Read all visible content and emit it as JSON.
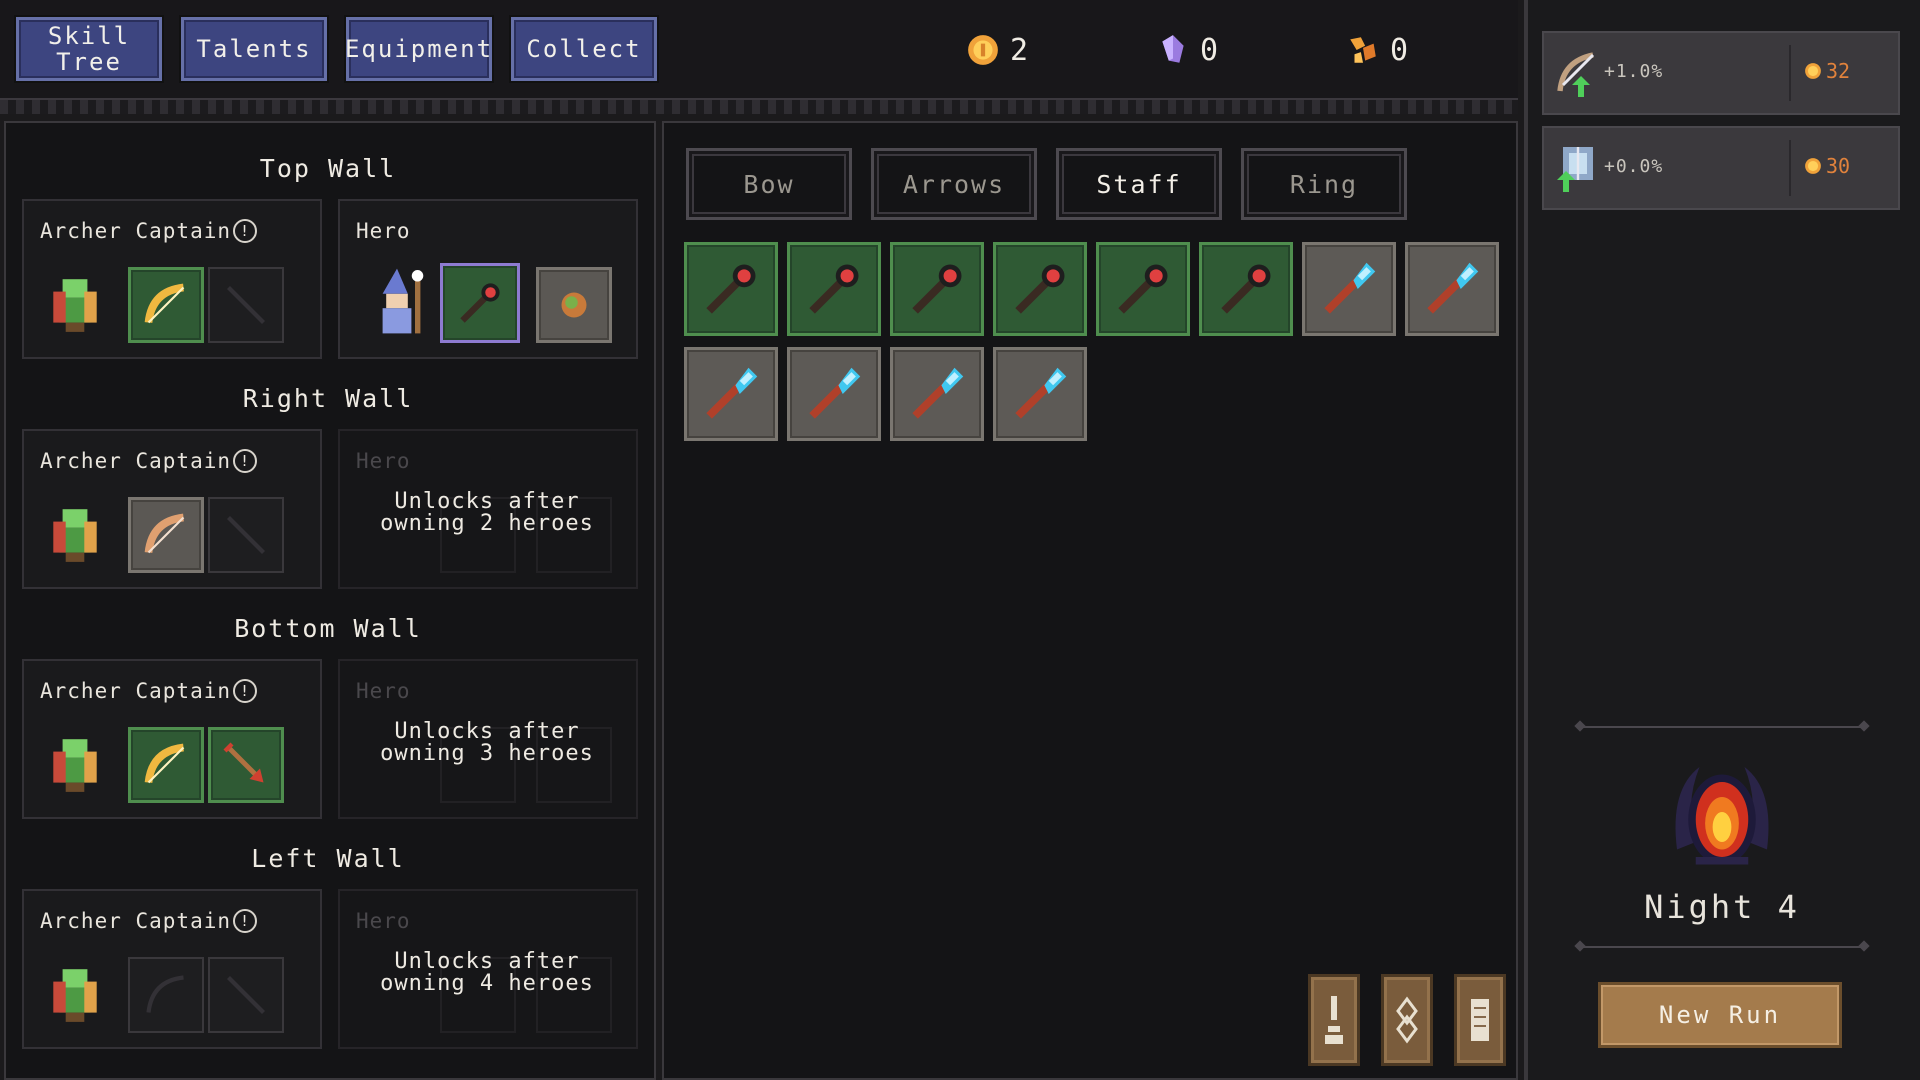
{
  "nav": {
    "tabs": [
      {
        "label": "Skill\nTree"
      },
      {
        "label": "Talents"
      },
      {
        "label": "Equipment"
      },
      {
        "label": "Collect"
      }
    ]
  },
  "currencies": [
    {
      "icon": "gold-coin-icon",
      "value": "2"
    },
    {
      "icon": "purple-crystal-icon",
      "value": "0"
    },
    {
      "icon": "orange-shard-icon",
      "value": "0"
    }
  ],
  "walls": [
    {
      "title": "Top Wall",
      "unit": "Archer Captain",
      "hero_label": "Hero",
      "unlock_text": ""
    },
    {
      "title": "Right Wall",
      "unit": "Archer Captain",
      "hero_label": "Hero",
      "unlock_text": "Unlocks after\nowning 2 heroes"
    },
    {
      "title": "Bottom Wall",
      "unit": "Archer Captain",
      "hero_label": "Hero",
      "unlock_text": "Unlocks after\nowning 3 heroes"
    },
    {
      "title": "Left Wall",
      "unit": "Archer Captain",
      "hero_label": "Hero",
      "unlock_text": "Unlocks after\nowning 4 heroes"
    }
  ],
  "info_glyph": "!",
  "equipment": {
    "categories": [
      {
        "label": "Bow"
      },
      {
        "label": "Arrows"
      },
      {
        "label": "Staff",
        "active": true
      },
      {
        "label": "Ring"
      }
    ],
    "inventory": [
      {
        "item": "red-gem-staff",
        "rarity": "green"
      },
      {
        "item": "red-gem-staff",
        "rarity": "green"
      },
      {
        "item": "red-gem-staff",
        "rarity": "green"
      },
      {
        "item": "red-gem-staff",
        "rarity": "green"
      },
      {
        "item": "red-gem-staff",
        "rarity": "green"
      },
      {
        "item": "red-gem-staff",
        "rarity": "green"
      },
      {
        "item": "blue-crystal-staff",
        "rarity": "grey"
      },
      {
        "item": "blue-crystal-staff",
        "rarity": "grey"
      },
      {
        "item": "blue-crystal-staff",
        "rarity": "grey"
      },
      {
        "item": "blue-crystal-staff",
        "rarity": "grey"
      },
      {
        "item": "blue-crystal-staff",
        "rarity": "grey"
      },
      {
        "item": "blue-crystal-staff",
        "rarity": "grey"
      }
    ]
  },
  "upgrades": [
    {
      "icon": "arrow-attack-upgrade-icon",
      "percent": "+1.0%",
      "cost": "32"
    },
    {
      "icon": "shield-defense-upgrade-icon",
      "percent": "+0.0%",
      "cost": "30"
    }
  ],
  "run": {
    "night_label": "Night 4",
    "new_run_label": "New Run"
  },
  "colors": {
    "tab_blue": "#3d4580",
    "slot_green": "#2f5a34",
    "slot_grey": "#5d5a56",
    "cost_orange": "#e0823c",
    "new_run_brown": "#a47b4c"
  }
}
